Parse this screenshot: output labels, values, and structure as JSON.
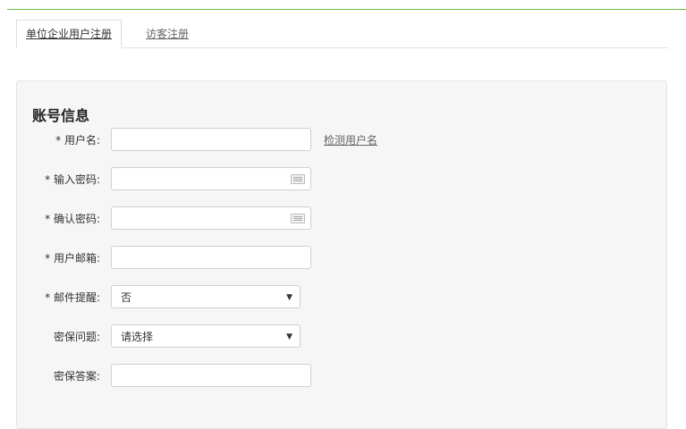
{
  "tabs": [
    {
      "label": "单位企业用户注册",
      "active": true
    },
    {
      "label": "访客注册",
      "active": false
    }
  ],
  "section": {
    "title": "账号信息"
  },
  "fields": {
    "username": {
      "label": "* 用户名:",
      "value": "",
      "action": "检测用户名"
    },
    "password": {
      "label": "* 输入密码:",
      "value": "",
      "icon": "keyboard-icon"
    },
    "confirm_password": {
      "label": "* 确认密码:",
      "value": "",
      "icon": "keyboard-icon"
    },
    "email": {
      "label": "* 用户邮箱:",
      "value": ""
    },
    "email_reminder": {
      "label": "* 邮件提醒:",
      "selected": "否"
    },
    "security_question": {
      "label": "密保问题:",
      "selected": "请选择"
    },
    "security_answer": {
      "label": "密保答案:",
      "value": ""
    }
  },
  "colors": {
    "accent": "#6fb446",
    "panel_bg": "#f6f6f6"
  }
}
